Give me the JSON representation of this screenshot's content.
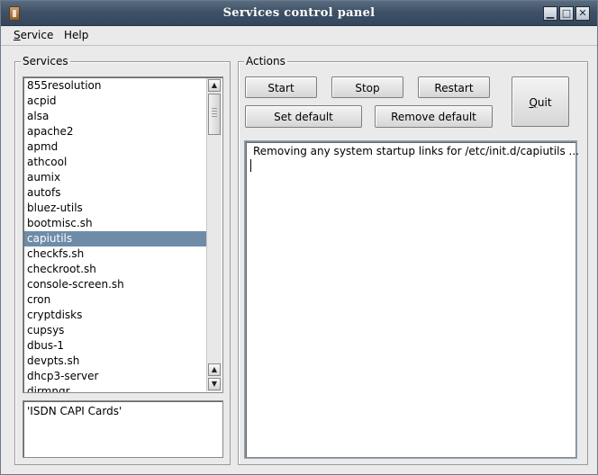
{
  "window": {
    "title": "Services control panel",
    "buttons": {
      "minimize": "▁",
      "maximize": "□",
      "close": "✕"
    }
  },
  "menu": {
    "service": {
      "mnemonic": "S",
      "rest": "ervice"
    },
    "help": "Help"
  },
  "services": {
    "legend": "Services",
    "items": [
      "855resolution",
      "acpid",
      "alsa",
      "apache2",
      "apmd",
      "athcool",
      "aumix",
      "autofs",
      "bluez-utils",
      "bootmisc.sh",
      "capiutils",
      "checkfs.sh",
      "checkroot.sh",
      "console-screen.sh",
      "cron",
      "cryptdisks",
      "cupsys",
      "dbus-1",
      "devpts.sh",
      "dhcp3-server",
      "dirmngr"
    ],
    "selected": "capiutils",
    "description": "'ISDN CAPI Cards'"
  },
  "actions": {
    "legend": "Actions",
    "start": "Start",
    "stop": "Stop",
    "restart": "Restart",
    "set_default": "Set default",
    "remove_default": "Remove default",
    "quit": {
      "mnemonic": "Q",
      "rest": "uit"
    }
  },
  "output": {
    "text": "Removing any system startup links for /etc/init.d/capiutils ..."
  },
  "colors": {
    "selection": "#6e8ca8",
    "titlebar": "#3f5166",
    "window_bg": "#eaeaea"
  }
}
